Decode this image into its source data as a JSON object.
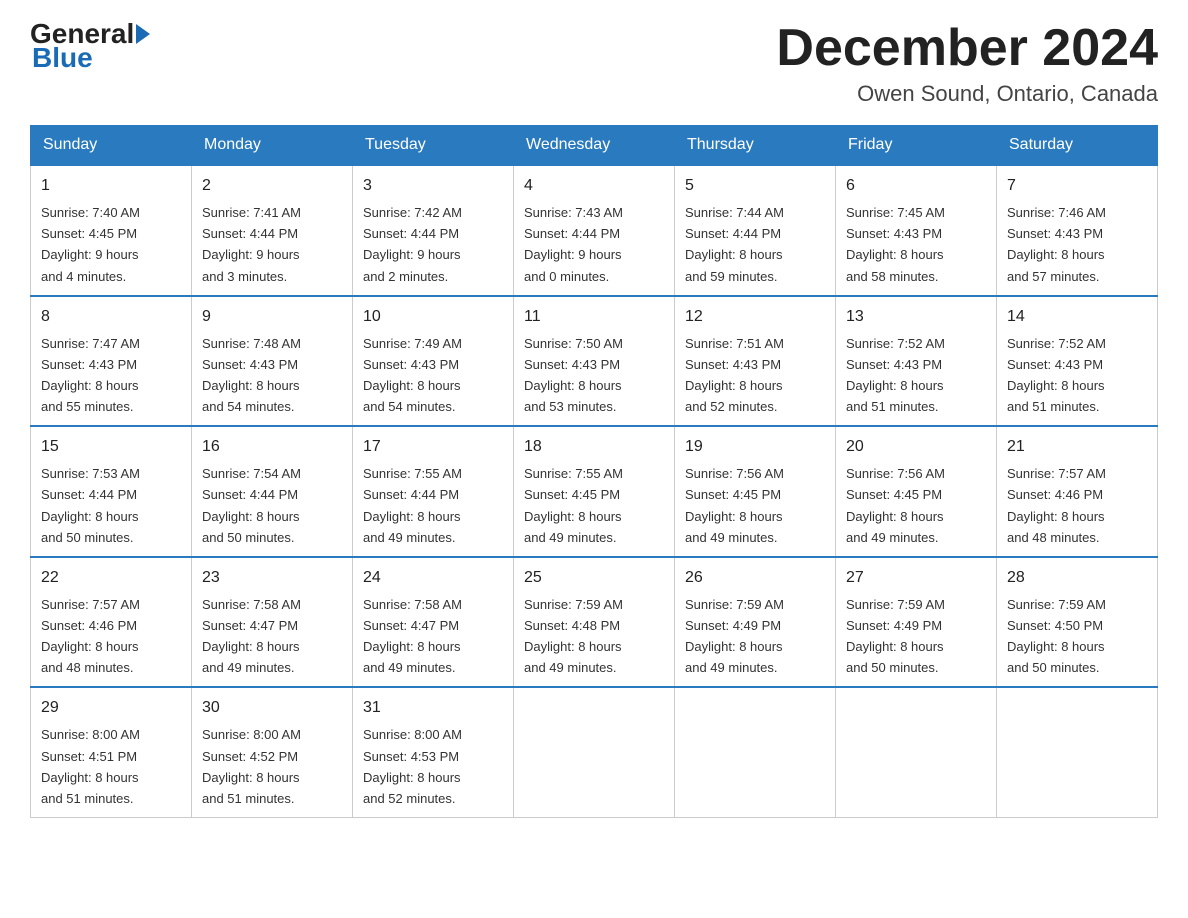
{
  "header": {
    "logo_general": "General",
    "logo_blue": "Blue",
    "month_title": "December 2024",
    "location": "Owen Sound, Ontario, Canada"
  },
  "weekdays": [
    "Sunday",
    "Monday",
    "Tuesday",
    "Wednesday",
    "Thursday",
    "Friday",
    "Saturday"
  ],
  "weeks": [
    [
      {
        "day": "1",
        "sunrise": "7:40 AM",
        "sunset": "4:45 PM",
        "daylight": "9 hours and 4 minutes."
      },
      {
        "day": "2",
        "sunrise": "7:41 AM",
        "sunset": "4:44 PM",
        "daylight": "9 hours and 3 minutes."
      },
      {
        "day": "3",
        "sunrise": "7:42 AM",
        "sunset": "4:44 PM",
        "daylight": "9 hours and 2 minutes."
      },
      {
        "day": "4",
        "sunrise": "7:43 AM",
        "sunset": "4:44 PM",
        "daylight": "9 hours and 0 minutes."
      },
      {
        "day": "5",
        "sunrise": "7:44 AM",
        "sunset": "4:44 PM",
        "daylight": "8 hours and 59 minutes."
      },
      {
        "day": "6",
        "sunrise": "7:45 AM",
        "sunset": "4:43 PM",
        "daylight": "8 hours and 58 minutes."
      },
      {
        "day": "7",
        "sunrise": "7:46 AM",
        "sunset": "4:43 PM",
        "daylight": "8 hours and 57 minutes."
      }
    ],
    [
      {
        "day": "8",
        "sunrise": "7:47 AM",
        "sunset": "4:43 PM",
        "daylight": "8 hours and 55 minutes."
      },
      {
        "day": "9",
        "sunrise": "7:48 AM",
        "sunset": "4:43 PM",
        "daylight": "8 hours and 54 minutes."
      },
      {
        "day": "10",
        "sunrise": "7:49 AM",
        "sunset": "4:43 PM",
        "daylight": "8 hours and 54 minutes."
      },
      {
        "day": "11",
        "sunrise": "7:50 AM",
        "sunset": "4:43 PM",
        "daylight": "8 hours and 53 minutes."
      },
      {
        "day": "12",
        "sunrise": "7:51 AM",
        "sunset": "4:43 PM",
        "daylight": "8 hours and 52 minutes."
      },
      {
        "day": "13",
        "sunrise": "7:52 AM",
        "sunset": "4:43 PM",
        "daylight": "8 hours and 51 minutes."
      },
      {
        "day": "14",
        "sunrise": "7:52 AM",
        "sunset": "4:43 PM",
        "daylight": "8 hours and 51 minutes."
      }
    ],
    [
      {
        "day": "15",
        "sunrise": "7:53 AM",
        "sunset": "4:44 PM",
        "daylight": "8 hours and 50 minutes."
      },
      {
        "day": "16",
        "sunrise": "7:54 AM",
        "sunset": "4:44 PM",
        "daylight": "8 hours and 50 minutes."
      },
      {
        "day": "17",
        "sunrise": "7:55 AM",
        "sunset": "4:44 PM",
        "daylight": "8 hours and 49 minutes."
      },
      {
        "day": "18",
        "sunrise": "7:55 AM",
        "sunset": "4:45 PM",
        "daylight": "8 hours and 49 minutes."
      },
      {
        "day": "19",
        "sunrise": "7:56 AM",
        "sunset": "4:45 PM",
        "daylight": "8 hours and 49 minutes."
      },
      {
        "day": "20",
        "sunrise": "7:56 AM",
        "sunset": "4:45 PM",
        "daylight": "8 hours and 49 minutes."
      },
      {
        "day": "21",
        "sunrise": "7:57 AM",
        "sunset": "4:46 PM",
        "daylight": "8 hours and 48 minutes."
      }
    ],
    [
      {
        "day": "22",
        "sunrise": "7:57 AM",
        "sunset": "4:46 PM",
        "daylight": "8 hours and 48 minutes."
      },
      {
        "day": "23",
        "sunrise": "7:58 AM",
        "sunset": "4:47 PM",
        "daylight": "8 hours and 49 minutes."
      },
      {
        "day": "24",
        "sunrise": "7:58 AM",
        "sunset": "4:47 PM",
        "daylight": "8 hours and 49 minutes."
      },
      {
        "day": "25",
        "sunrise": "7:59 AM",
        "sunset": "4:48 PM",
        "daylight": "8 hours and 49 minutes."
      },
      {
        "day": "26",
        "sunrise": "7:59 AM",
        "sunset": "4:49 PM",
        "daylight": "8 hours and 49 minutes."
      },
      {
        "day": "27",
        "sunrise": "7:59 AM",
        "sunset": "4:49 PM",
        "daylight": "8 hours and 50 minutes."
      },
      {
        "day": "28",
        "sunrise": "7:59 AM",
        "sunset": "4:50 PM",
        "daylight": "8 hours and 50 minutes."
      }
    ],
    [
      {
        "day": "29",
        "sunrise": "8:00 AM",
        "sunset": "4:51 PM",
        "daylight": "8 hours and 51 minutes."
      },
      {
        "day": "30",
        "sunrise": "8:00 AM",
        "sunset": "4:52 PM",
        "daylight": "8 hours and 51 minutes."
      },
      {
        "day": "31",
        "sunrise": "8:00 AM",
        "sunset": "4:53 PM",
        "daylight": "8 hours and 52 minutes."
      },
      null,
      null,
      null,
      null
    ]
  ],
  "labels": {
    "sunrise": "Sunrise:",
    "sunset": "Sunset:",
    "daylight": "Daylight:"
  }
}
